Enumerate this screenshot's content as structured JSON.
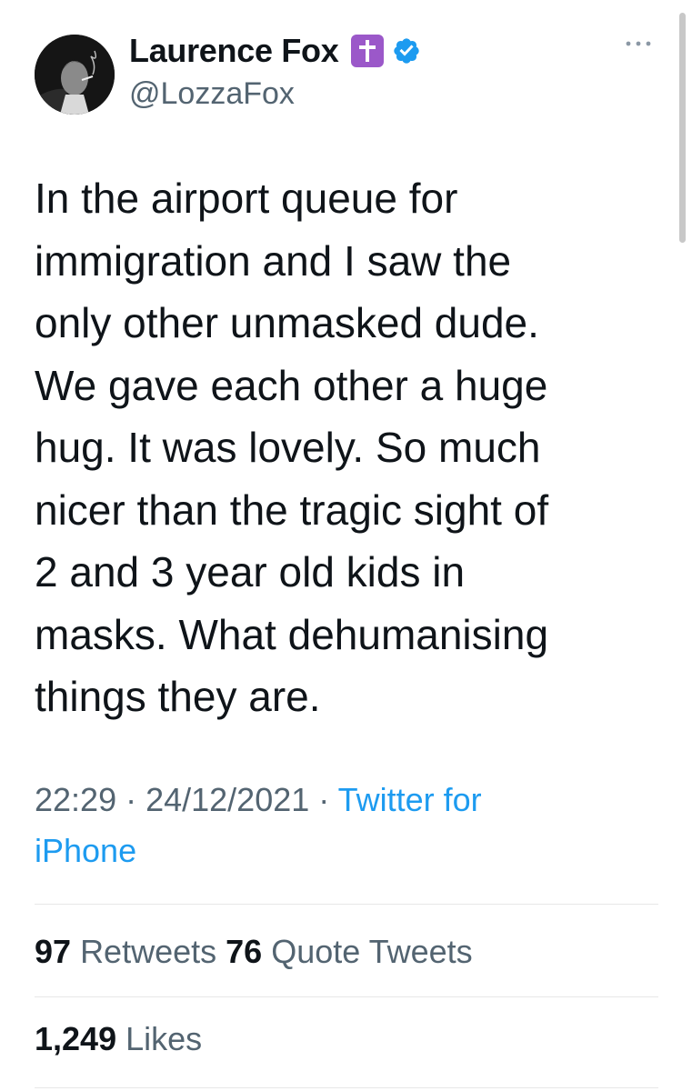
{
  "author": {
    "display_name": "Laurence Fox",
    "handle": "@LozzaFox"
  },
  "icons": {
    "avatar": "profile-photo",
    "badge_1": "latin-cross-emoji",
    "badge_2": "verified-checkmark-icon",
    "more": "more-horizontal-icon"
  },
  "colors": {
    "link_blue": "#1d9bf0",
    "muted_gray": "#536471",
    "cross_badge_purple": "#9b58c9"
  },
  "tweet": {
    "text_lines": [
      "In the airport queue for",
      "immigration and I saw the",
      "only other unmasked dude.",
      "We gave each other a huge",
      "hug. It was lovely. So much",
      "nicer than the tragic sight of",
      "2 and 3 year old kids in",
      "masks. What dehumanising",
      "things they are."
    ]
  },
  "meta": {
    "time": "22:29",
    "separator": " · ",
    "date": "24/12/2021",
    "source_line_1": "Twitter for",
    "source_line_2": "iPhone"
  },
  "stats": {
    "retweets_count": "97",
    "retweets_label": "Retweets",
    "quotes_count": "76",
    "quotes_label": "Quote Tweets",
    "likes_count": "1,249",
    "likes_label": "Likes"
  }
}
